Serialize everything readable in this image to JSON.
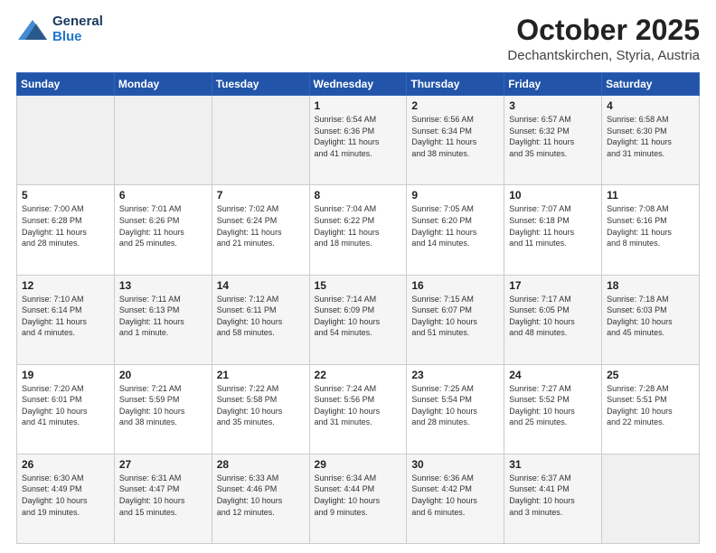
{
  "header": {
    "logo_line1": "General",
    "logo_line2": "Blue",
    "month": "October 2025",
    "location": "Dechantskirchen, Styria, Austria"
  },
  "weekdays": [
    "Sunday",
    "Monday",
    "Tuesday",
    "Wednesday",
    "Thursday",
    "Friday",
    "Saturday"
  ],
  "weeks": [
    [
      {
        "day": "",
        "info": ""
      },
      {
        "day": "",
        "info": ""
      },
      {
        "day": "",
        "info": ""
      },
      {
        "day": "1",
        "info": "Sunrise: 6:54 AM\nSunset: 6:36 PM\nDaylight: 11 hours\nand 41 minutes."
      },
      {
        "day": "2",
        "info": "Sunrise: 6:56 AM\nSunset: 6:34 PM\nDaylight: 11 hours\nand 38 minutes."
      },
      {
        "day": "3",
        "info": "Sunrise: 6:57 AM\nSunset: 6:32 PM\nDaylight: 11 hours\nand 35 minutes."
      },
      {
        "day": "4",
        "info": "Sunrise: 6:58 AM\nSunset: 6:30 PM\nDaylight: 11 hours\nand 31 minutes."
      }
    ],
    [
      {
        "day": "5",
        "info": "Sunrise: 7:00 AM\nSunset: 6:28 PM\nDaylight: 11 hours\nand 28 minutes."
      },
      {
        "day": "6",
        "info": "Sunrise: 7:01 AM\nSunset: 6:26 PM\nDaylight: 11 hours\nand 25 minutes."
      },
      {
        "day": "7",
        "info": "Sunrise: 7:02 AM\nSunset: 6:24 PM\nDaylight: 11 hours\nand 21 minutes."
      },
      {
        "day": "8",
        "info": "Sunrise: 7:04 AM\nSunset: 6:22 PM\nDaylight: 11 hours\nand 18 minutes."
      },
      {
        "day": "9",
        "info": "Sunrise: 7:05 AM\nSunset: 6:20 PM\nDaylight: 11 hours\nand 14 minutes."
      },
      {
        "day": "10",
        "info": "Sunrise: 7:07 AM\nSunset: 6:18 PM\nDaylight: 11 hours\nand 11 minutes."
      },
      {
        "day": "11",
        "info": "Sunrise: 7:08 AM\nSunset: 6:16 PM\nDaylight: 11 hours\nand 8 minutes."
      }
    ],
    [
      {
        "day": "12",
        "info": "Sunrise: 7:10 AM\nSunset: 6:14 PM\nDaylight: 11 hours\nand 4 minutes."
      },
      {
        "day": "13",
        "info": "Sunrise: 7:11 AM\nSunset: 6:13 PM\nDaylight: 11 hours\nand 1 minute."
      },
      {
        "day": "14",
        "info": "Sunrise: 7:12 AM\nSunset: 6:11 PM\nDaylight: 10 hours\nand 58 minutes."
      },
      {
        "day": "15",
        "info": "Sunrise: 7:14 AM\nSunset: 6:09 PM\nDaylight: 10 hours\nand 54 minutes."
      },
      {
        "day": "16",
        "info": "Sunrise: 7:15 AM\nSunset: 6:07 PM\nDaylight: 10 hours\nand 51 minutes."
      },
      {
        "day": "17",
        "info": "Sunrise: 7:17 AM\nSunset: 6:05 PM\nDaylight: 10 hours\nand 48 minutes."
      },
      {
        "day": "18",
        "info": "Sunrise: 7:18 AM\nSunset: 6:03 PM\nDaylight: 10 hours\nand 45 minutes."
      }
    ],
    [
      {
        "day": "19",
        "info": "Sunrise: 7:20 AM\nSunset: 6:01 PM\nDaylight: 10 hours\nand 41 minutes."
      },
      {
        "day": "20",
        "info": "Sunrise: 7:21 AM\nSunset: 5:59 PM\nDaylight: 10 hours\nand 38 minutes."
      },
      {
        "day": "21",
        "info": "Sunrise: 7:22 AM\nSunset: 5:58 PM\nDaylight: 10 hours\nand 35 minutes."
      },
      {
        "day": "22",
        "info": "Sunrise: 7:24 AM\nSunset: 5:56 PM\nDaylight: 10 hours\nand 31 minutes."
      },
      {
        "day": "23",
        "info": "Sunrise: 7:25 AM\nSunset: 5:54 PM\nDaylight: 10 hours\nand 28 minutes."
      },
      {
        "day": "24",
        "info": "Sunrise: 7:27 AM\nSunset: 5:52 PM\nDaylight: 10 hours\nand 25 minutes."
      },
      {
        "day": "25",
        "info": "Sunrise: 7:28 AM\nSunset: 5:51 PM\nDaylight: 10 hours\nand 22 minutes."
      }
    ],
    [
      {
        "day": "26",
        "info": "Sunrise: 6:30 AM\nSunset: 4:49 PM\nDaylight: 10 hours\nand 19 minutes."
      },
      {
        "day": "27",
        "info": "Sunrise: 6:31 AM\nSunset: 4:47 PM\nDaylight: 10 hours\nand 15 minutes."
      },
      {
        "day": "28",
        "info": "Sunrise: 6:33 AM\nSunset: 4:46 PM\nDaylight: 10 hours\nand 12 minutes."
      },
      {
        "day": "29",
        "info": "Sunrise: 6:34 AM\nSunset: 4:44 PM\nDaylight: 10 hours\nand 9 minutes."
      },
      {
        "day": "30",
        "info": "Sunrise: 6:36 AM\nSunset: 4:42 PM\nDaylight: 10 hours\nand 6 minutes."
      },
      {
        "day": "31",
        "info": "Sunrise: 6:37 AM\nSunset: 4:41 PM\nDaylight: 10 hours\nand 3 minutes."
      },
      {
        "day": "",
        "info": ""
      }
    ]
  ]
}
